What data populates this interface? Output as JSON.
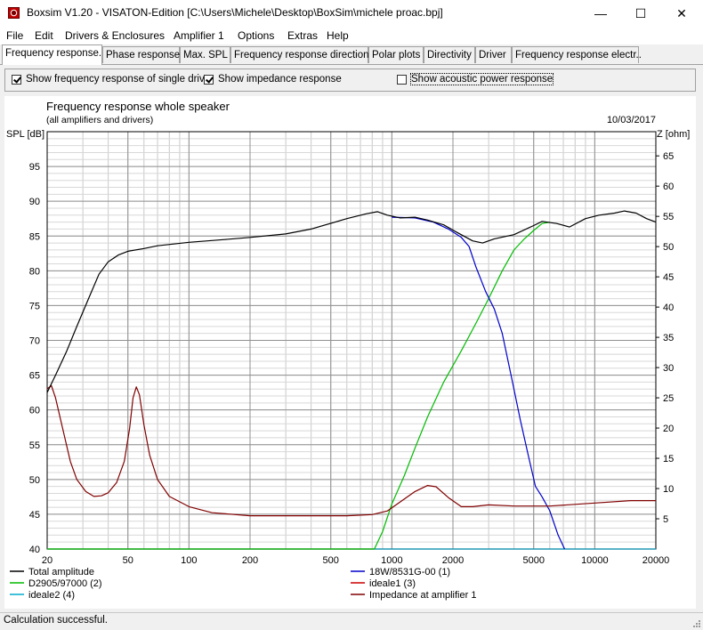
{
  "window": {
    "title": "Boxsim V1.20 - VISATON-Edition [C:\\Users\\Michele\\Desktop\\BoxSim\\michele proac.bpj]",
    "minimize": "—",
    "maximize": "☐",
    "close": "✕"
  },
  "menu": [
    "File",
    "Edit",
    "Drivers & Enclosures",
    "Amplifier 1",
    "Options",
    "Extras",
    "Help"
  ],
  "tabs": [
    "Frequency response.",
    "Phase response",
    "Max. SPL",
    "Frequency response directions",
    "Polar plots",
    "Directivity",
    "Driver",
    "Frequency response electr.."
  ],
  "active_tab": 0,
  "options": {
    "single_drive": {
      "label": "Show frequency response of single drive",
      "checked": true
    },
    "impedance": {
      "label": "Show impedance response",
      "checked": true
    },
    "acoustic_power": {
      "label": "Show acoustic power response",
      "checked": false
    }
  },
  "status": "Calculation successful.",
  "chart_data": {
    "type": "line",
    "title": "Frequency response whole speaker",
    "subtitle": "(all amplifiers and drivers)",
    "date": "10/03/2017",
    "ylabel": "SPL [dB]",
    "y2label": "Z [ohm]",
    "xscale": "log",
    "xlim": [
      20,
      20000
    ],
    "ylim": [
      40,
      100
    ],
    "y2lim": [
      0,
      69
    ],
    "xticks": [
      20,
      50,
      100,
      200,
      500,
      1000,
      2000,
      5000,
      10000,
      20000
    ],
    "yticks": [
      40,
      45,
      50,
      55,
      60,
      65,
      70,
      75,
      80,
      85,
      90,
      95
    ],
    "y2ticks": [
      5,
      10,
      15,
      20,
      25,
      30,
      35,
      40,
      45,
      50,
      55,
      60,
      65
    ],
    "grid": true,
    "legend_position": "bottom",
    "series": [
      {
        "name": "Total amplitude",
        "color": "#000000",
        "axis": "left",
        "points": [
          [
            20,
            62.5
          ],
          [
            22,
            65
          ],
          [
            25,
            68.5
          ],
          [
            28,
            72
          ],
          [
            32,
            76
          ],
          [
            36,
            79.5
          ],
          [
            40,
            81.3
          ],
          [
            45,
            82.3
          ],
          [
            50,
            82.8
          ],
          [
            60,
            83.2
          ],
          [
            70,
            83.6
          ],
          [
            100,
            84.1
          ],
          [
            150,
            84.5
          ],
          [
            200,
            84.8
          ],
          [
            300,
            85.3
          ],
          [
            400,
            86.0
          ],
          [
            600,
            87.5
          ],
          [
            750,
            88.2
          ],
          [
            850,
            88.5
          ],
          [
            950,
            88.0
          ],
          [
            1100,
            87.6
          ],
          [
            1300,
            87.7
          ],
          [
            1500,
            87.3
          ],
          [
            1800,
            86.6
          ],
          [
            2100,
            85.5
          ],
          [
            2500,
            84.3
          ],
          [
            2800,
            84.0
          ],
          [
            3200,
            84.6
          ],
          [
            4000,
            85.2
          ],
          [
            5000,
            86.5
          ],
          [
            5500,
            87.1
          ],
          [
            6500,
            86.8
          ],
          [
            7500,
            86.3
          ],
          [
            9000,
            87.5
          ],
          [
            10500,
            88.0
          ],
          [
            12500,
            88.3
          ],
          [
            14000,
            88.6
          ],
          [
            16000,
            88.3
          ],
          [
            18000,
            87.5
          ],
          [
            20000,
            87.0
          ]
        ]
      },
      {
        "name": "18W/8531G-00 (1)",
        "color": "#0000cc",
        "axis": "left",
        "points": [
          [
            1000,
            87.7
          ],
          [
            1300,
            87.6
          ],
          [
            1600,
            87.0
          ],
          [
            1900,
            86.0
          ],
          [
            2200,
            84.8
          ],
          [
            2400,
            83.5
          ],
          [
            2600,
            80.5
          ],
          [
            2900,
            77.0
          ],
          [
            3200,
            74.5
          ],
          [
            3500,
            71.0
          ],
          [
            3900,
            64.5
          ],
          [
            4300,
            58.5
          ],
          [
            4700,
            53.5
          ],
          [
            5100,
            49.0
          ],
          [
            5500,
            47.5
          ],
          [
            6000,
            45.5
          ],
          [
            6600,
            42.0
          ],
          [
            7100,
            40.0
          ]
        ]
      },
      {
        "name": "D2905/97000 (2)",
        "color": "#00bb00",
        "axis": "left",
        "points": [
          [
            20,
            40
          ],
          [
            820,
            40
          ],
          [
            900,
            42.5
          ],
          [
            1000,
            46.5
          ],
          [
            1150,
            50.5
          ],
          [
            1300,
            54.5
          ],
          [
            1500,
            59.0
          ],
          [
            1800,
            64.0
          ],
          [
            2200,
            68.5
          ],
          [
            2600,
            72.5
          ],
          [
            3000,
            76.0
          ],
          [
            3500,
            80.0
          ],
          [
            4000,
            83.0
          ],
          [
            4500,
            84.6
          ],
          [
            5000,
            85.8
          ],
          [
            5500,
            86.8
          ],
          [
            6000,
            87.0
          ]
        ]
      },
      {
        "name": "ideale1 (3)",
        "color": "#cc0000",
        "axis": "left",
        "points": [
          [
            20,
            40
          ],
          [
            20000,
            40
          ]
        ]
      },
      {
        "name": "ideale2 (4)",
        "color": "#00aacc",
        "axis": "left",
        "points": [
          [
            20,
            40
          ],
          [
            20000,
            40
          ]
        ]
      },
      {
        "name": "Impedance at amplifier 1",
        "color": "#800000",
        "axis": "right",
        "points": [
          [
            20,
            26.5
          ],
          [
            21,
            27.0
          ],
          [
            22,
            25.0
          ],
          [
            24,
            19.5
          ],
          [
            26,
            14.5
          ],
          [
            28,
            11.5
          ],
          [
            31,
            9.5
          ],
          [
            34,
            8.7
          ],
          [
            37,
            8.8
          ],
          [
            40,
            9.3
          ],
          [
            44,
            11.0
          ],
          [
            48,
            14.5
          ],
          [
            51,
            20.0
          ],
          [
            53,
            25.0
          ],
          [
            55,
            26.8
          ],
          [
            57,
            25.5
          ],
          [
            60,
            20.5
          ],
          [
            64,
            15.5
          ],
          [
            70,
            11.5
          ],
          [
            80,
            8.7
          ],
          [
            100,
            7.0
          ],
          [
            130,
            6.0
          ],
          [
            200,
            5.5
          ],
          [
            400,
            5.5
          ],
          [
            600,
            5.5
          ],
          [
            800,
            5.7
          ],
          [
            950,
            6.3
          ],
          [
            1100,
            7.8
          ],
          [
            1300,
            9.5
          ],
          [
            1500,
            10.5
          ],
          [
            1650,
            10.3
          ],
          [
            1900,
            8.5
          ],
          [
            2200,
            7.0
          ],
          [
            2500,
            7.0
          ],
          [
            3000,
            7.3
          ],
          [
            4000,
            7.1
          ],
          [
            6000,
            7.1
          ],
          [
            10000,
            7.6
          ],
          [
            15000,
            8.0
          ],
          [
            20000,
            8.0
          ]
        ]
      }
    ]
  }
}
